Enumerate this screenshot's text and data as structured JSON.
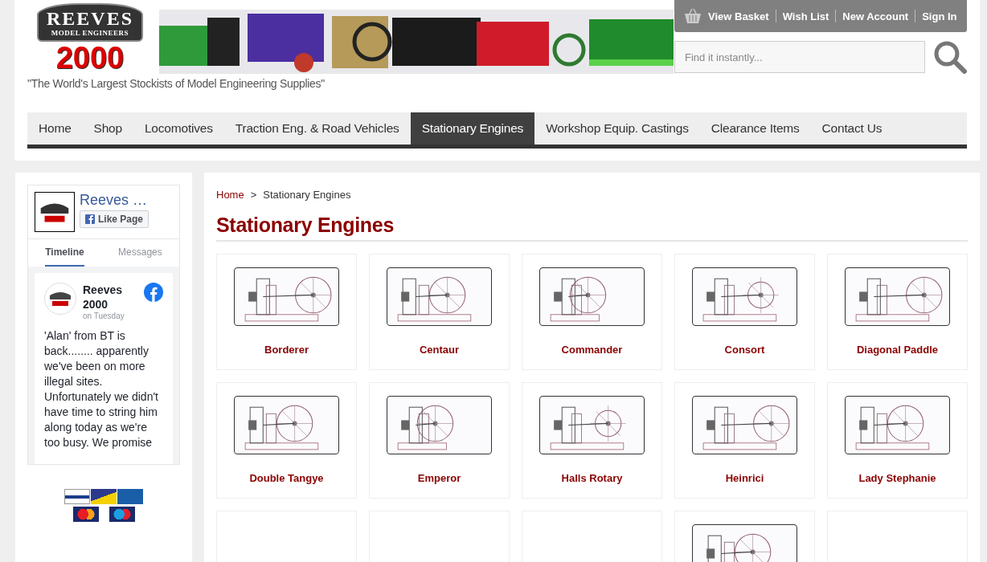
{
  "logo": {
    "plate_top": "REEVES",
    "plate_bottom": "MODEL ENGINEERS",
    "number": "2000"
  },
  "tagline": "\"The World's Largest Stockists of Model Engineering Supplies\"",
  "account_links": [
    "View Basket",
    "Wish List",
    "New Account",
    "Sign In"
  ],
  "search": {
    "placeholder": "Find it instantly..."
  },
  "nav": [
    {
      "label": "Home",
      "selected": false
    },
    {
      "label": "Shop",
      "selected": false
    },
    {
      "label": "Locomotives",
      "selected": false
    },
    {
      "label": "Traction Eng. & Road Vehicles",
      "selected": false
    },
    {
      "label": "Stationary Engines",
      "selected": true
    },
    {
      "label": "Workshop Equip. Castings",
      "selected": false
    },
    {
      "label": "Clearance Items",
      "selected": false
    },
    {
      "label": "Contact Us",
      "selected": false
    }
  ],
  "facebook": {
    "page_name": "Reeves …",
    "like_button": "Like Page",
    "tabs": [
      {
        "label": "Timeline",
        "selected": true
      },
      {
        "label": "Messages",
        "selected": false
      }
    ],
    "post": {
      "author": "Reeves 2000",
      "time": "on Tuesday",
      "text": "'Alan' from BT is back........ apparently we've been on more illegal sites. Unfortunately we didn't have time to string him along today as we're too busy. We promise"
    }
  },
  "payment_cards": [
    {
      "kind": "visa"
    },
    {
      "kind": "delta"
    },
    {
      "kind": "electron"
    },
    {
      "kind": "mastercard"
    },
    {
      "kind": "maestro"
    }
  ],
  "breadcrumb": [
    "Home",
    ">",
    "Stationary Engines"
  ],
  "title": "Stationary Engines",
  "products": [
    {
      "name": "Borderer",
      "image": true
    },
    {
      "name": "Centaur",
      "image": true
    },
    {
      "name": "Commander",
      "image": true
    },
    {
      "name": "Consort",
      "image": true
    },
    {
      "name": "Diagonal Paddle",
      "image": true
    },
    {
      "name": "Double Tangye",
      "image": true
    },
    {
      "name": "Emperor",
      "image": true
    },
    {
      "name": "Halls Rotary",
      "image": true
    },
    {
      "name": "Heinrici",
      "image": true
    },
    {
      "name": "Lady Stephanie",
      "image": true
    },
    {
      "image": false
    },
    {
      "image": false
    },
    {
      "image": false
    },
    {
      "image": true
    },
    {
      "image": false
    }
  ]
}
